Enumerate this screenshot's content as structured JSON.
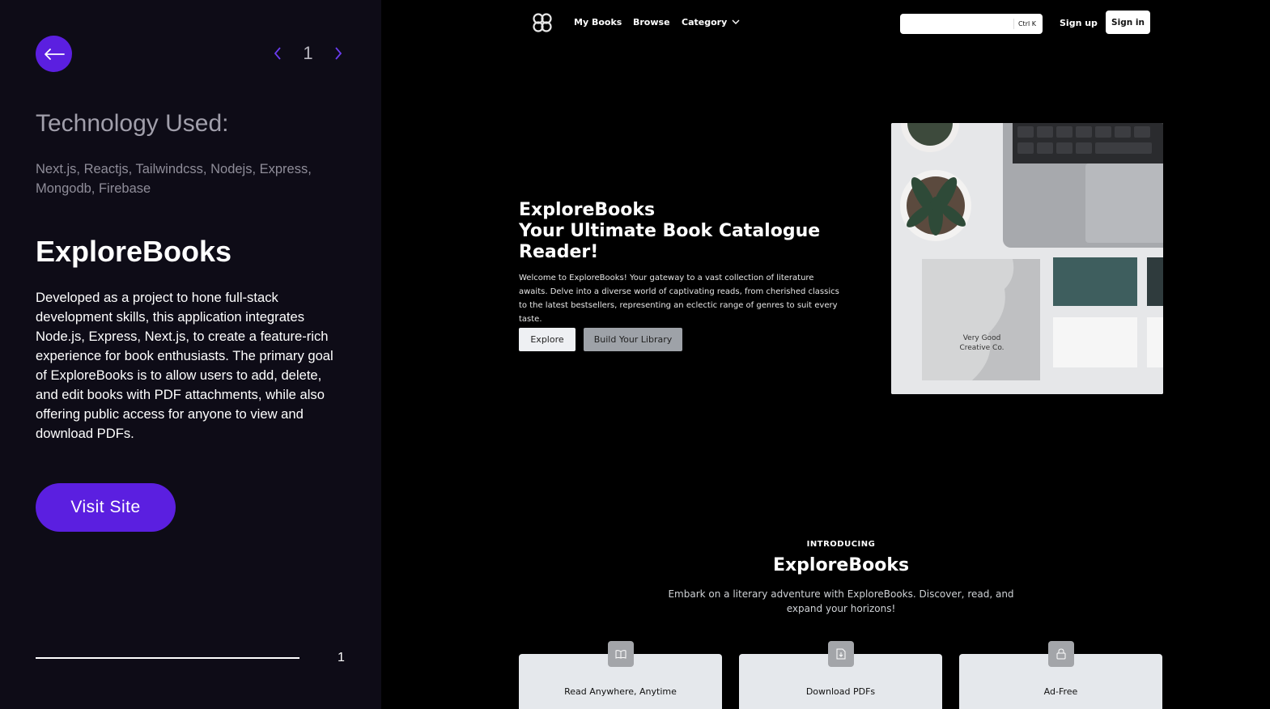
{
  "left": {
    "page_number": "1",
    "tech_heading": "Technology Used:",
    "tech_list": "Next.js, Reactjs, Tailwindcss, Nodejs, Express, Mongodb, Firebase",
    "project_title": "ExploreBooks",
    "project_description": "Developed as a project to hone full-stack development skills, this application integrates Node.js, Express, Next.js, to create a feature-rich experience for book enthusiasts. The primary goal of ExploreBooks is to allow users to add, delete, and edit books with PDF attachments, while also offering public access for anyone to view and download PDFs.",
    "visit_label": "Visit Site",
    "progress_number": "1",
    "accent_color": "#5b1fe0"
  },
  "site": {
    "nav": {
      "my_books": "My Books",
      "browse": "Browse",
      "category": "Category",
      "search_shortcut": "Ctrl K",
      "sign_up": "Sign up",
      "sign_in": "Sign in"
    },
    "hero": {
      "title_line1": "ExploreBooks",
      "title_line2": "Your Ultimate Book Catalogue",
      "title_line3": "Reader!",
      "description": "Welcome to ExploreBooks! Your gateway to a vast collection of literature awaits. Delve into a diverse world of captivating reads, from cherished classics to the latest bestsellers, representing an eclectic range of genres to suit every taste.",
      "explore_label": "Explore",
      "build_label": "Build Your Library",
      "image_card_text_line1": "Very Good",
      "image_card_text_line2": "Creative Co."
    },
    "intro": {
      "kicker": "INTRODUCING",
      "title": "ExploreBooks",
      "description": "Embark on a literary adventure with ExploreBooks. Discover, read, and expand your horizons!"
    },
    "features": [
      {
        "label": "Read Anywhere, Anytime",
        "icon": "book-open-icon"
      },
      {
        "label": "Download PDFs",
        "icon": "file-download-icon"
      },
      {
        "label": "Ad-Free",
        "icon": "lock-icon"
      }
    ]
  }
}
